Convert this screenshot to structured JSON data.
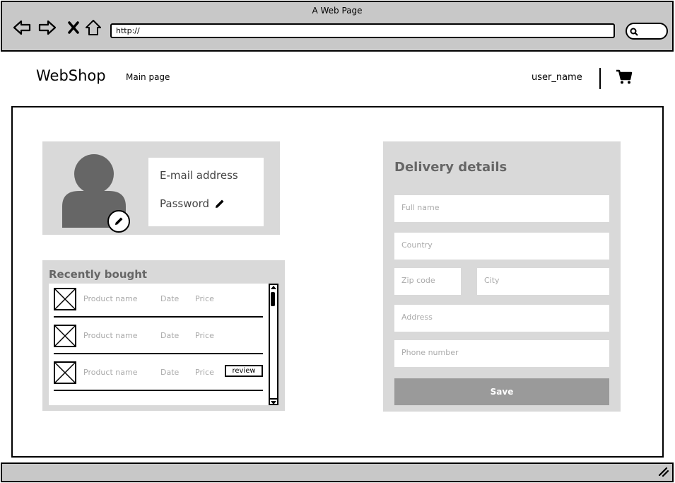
{
  "browser": {
    "window_title": "A Web Page",
    "url": "http://"
  },
  "header": {
    "logo": "WebShop",
    "main_link": "Main page",
    "user_name": "user_name"
  },
  "profile": {
    "email_label": "E-mail address",
    "password_label": "Password"
  },
  "recent": {
    "title": "Recently bought",
    "items": [
      {
        "name": "Product name",
        "date": "Date",
        "price": "Price"
      },
      {
        "name": "Product name",
        "date": "Date",
        "price": "Price"
      },
      {
        "name": "Product name",
        "date": "Date",
        "price": "Price",
        "action": "review"
      }
    ]
  },
  "delivery": {
    "title": "Delivery details",
    "full_name_placeholder": "Full name",
    "country_placeholder": "Country",
    "zip_placeholder": "Zip code",
    "city_placeholder": "City",
    "address_placeholder": "Address",
    "phone_placeholder": "Phone number",
    "save_label": "Save"
  },
  "colors": {
    "chrome": "#c8c8c8",
    "panel": "#d9d9d9",
    "avatar": "#666666",
    "button": "#9a9a9a"
  }
}
